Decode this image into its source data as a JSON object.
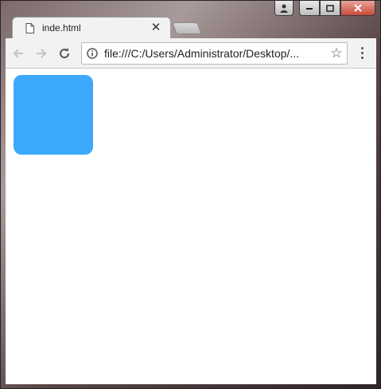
{
  "window": {
    "controls": {
      "profile": "👤",
      "minimize": "▁",
      "maximize": "❐",
      "close": "✕"
    }
  },
  "tab": {
    "title": "inde.html",
    "close": "✕"
  },
  "toolbar": {
    "url": "file:///C:/Users/Administrator/Desktop/...",
    "star": "☆"
  },
  "page": {
    "box_color": "#3da9fc"
  },
  "icons": {
    "back": "arrow-left-icon",
    "forward": "arrow-right-icon",
    "reload": "reload-icon",
    "info": "info-icon",
    "star": "star-icon",
    "menu": "vertical-dots-icon",
    "favicon": "document-icon"
  }
}
